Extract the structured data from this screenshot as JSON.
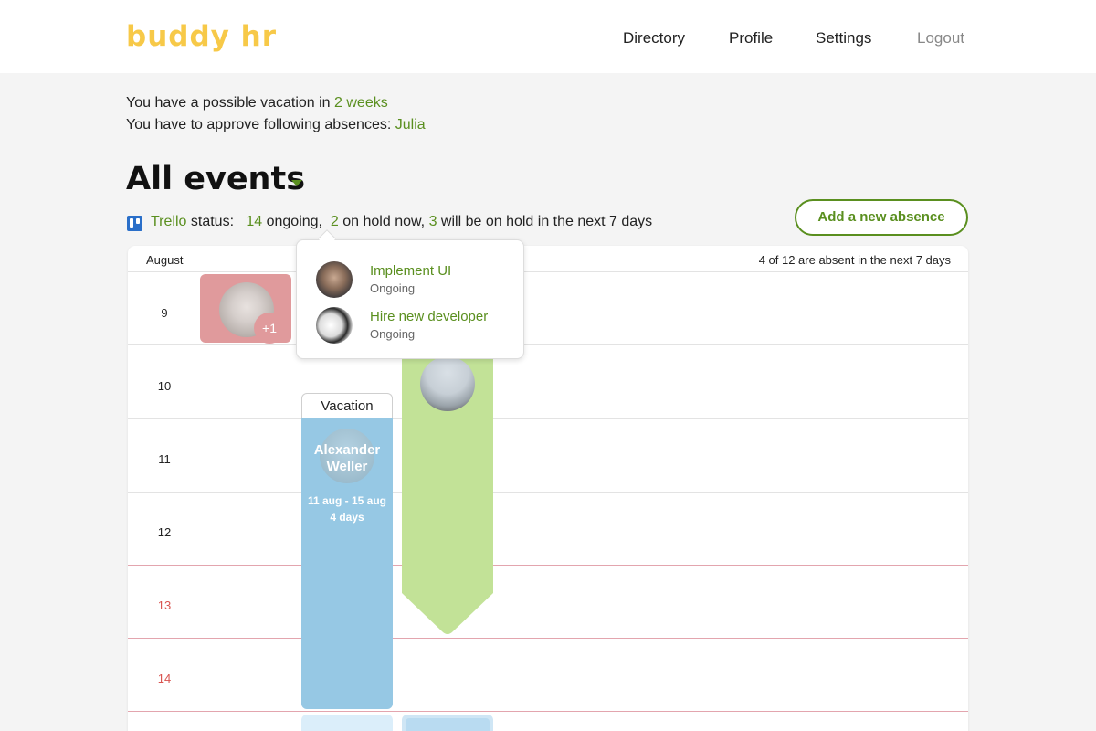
{
  "app": {
    "logo": "buddy hr"
  },
  "nav": {
    "directory": "Directory",
    "profile": "Profile",
    "settings": "Settings",
    "logout": "Logout"
  },
  "notices": {
    "vacation_prefix": "You have a possible vacation in ",
    "vacation_link": "2 weeks",
    "approve_prefix": "You have to approve following absences: ",
    "approve_link": "Julia"
  },
  "page": {
    "title": "All events"
  },
  "trello": {
    "link": "Trello",
    "status_label": "status:",
    "ongoing_count": "14",
    "ongoing_label": "ongoing,",
    "hold_count": "2",
    "hold_label": "on hold now,",
    "next_count": "3",
    "next_label": "will be on hold in the next 7 days"
  },
  "add_button": "Add a new absence",
  "calendar": {
    "month": "August",
    "summary": "4 of 12 are absent in the next 7 days",
    "days": [
      "9",
      "10",
      "11",
      "12",
      "13",
      "14"
    ],
    "weekend_days": [
      "13",
      "14"
    ]
  },
  "events": {
    "first_badge": "+1",
    "vacation": {
      "tab": "Vacation",
      "name_line1": "Alexander",
      "name_line2": "Weller",
      "dates": "11 aug - 15 aug",
      "duration": "4 days",
      "color": "#96c8e4"
    },
    "green_color": "#c2e297",
    "red_color": "#e09a9c"
  },
  "popover": {
    "items": [
      {
        "title": "Implement UI",
        "status": "Ongoing"
      },
      {
        "title": "Hire new developer",
        "status": "Ongoing"
      }
    ]
  },
  "colors": {
    "accent": "#5a8f1f",
    "logo": "#f7c948",
    "weekend": "#d9534f"
  }
}
